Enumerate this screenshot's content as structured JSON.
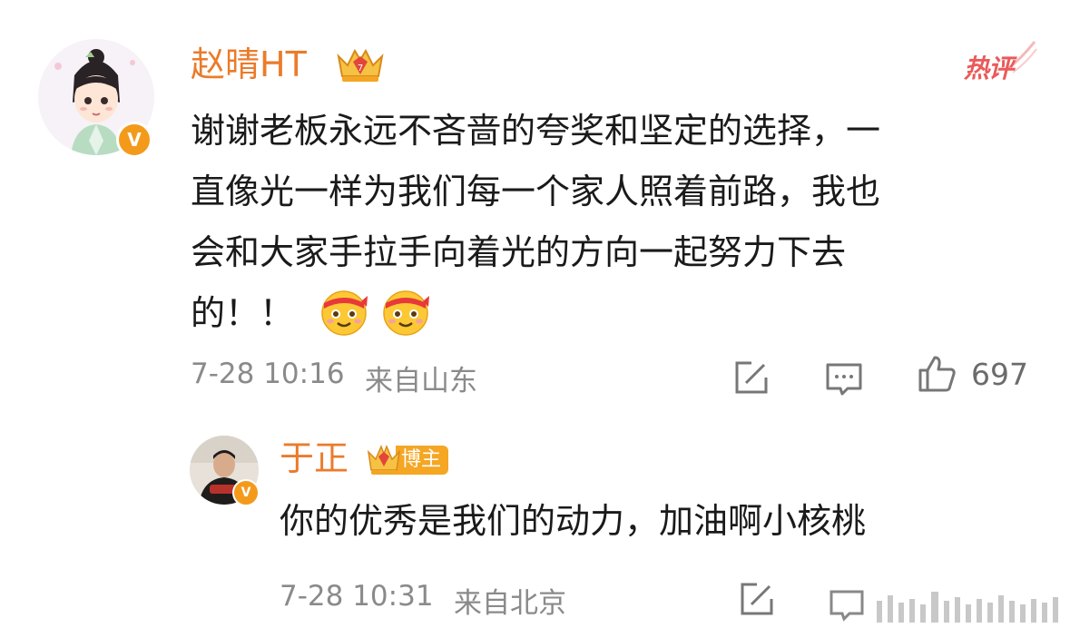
{
  "main_comment": {
    "username": "赵晴HT",
    "hot_label": "热评",
    "text_lines": [
      "谢谢老板永远不吝啬的夸奖和坚定的选择，一",
      "直像光一样为我们每一个家人照着前路，我也",
      "会和大家手拉手向着光的方向一起努力下去",
      "的！！"
    ],
    "emojis": [
      "party-face-emoji",
      "party-face-emoji"
    ],
    "timestamp": "7-28 10:16",
    "location": "来自山东",
    "like_count": "697",
    "verified_badge": "V"
  },
  "reply": {
    "username": "于正",
    "role_tag": "博主",
    "text": "你的优秀是我们的动力，加油啊小核桃",
    "timestamp": "7-28 10:31",
    "location": "来自北京",
    "verified_badge": "V"
  },
  "colors": {
    "username": "#eb7b2a",
    "hot": "#ea5a5a",
    "verified": "#f49a1b",
    "meta": "#8a8a8a"
  }
}
